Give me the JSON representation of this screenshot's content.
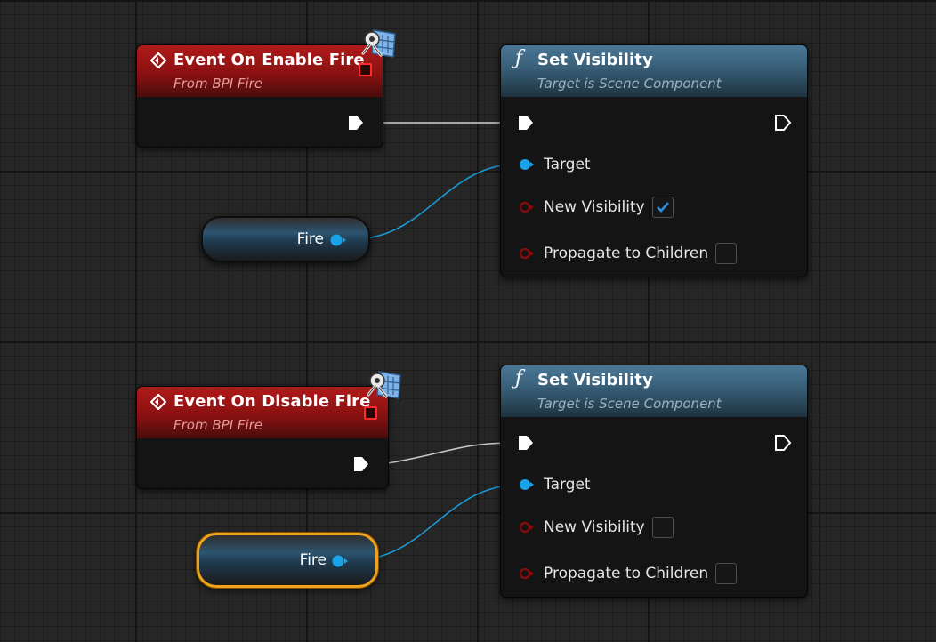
{
  "graph": {
    "event_nodes": [
      {
        "title": "Event On Enable Fire",
        "subtitle": "From BPI Fire"
      },
      {
        "title": "Event On Disable Fire",
        "subtitle": "From BPI Fire"
      }
    ],
    "function_nodes": [
      {
        "title": "Set Visibility",
        "subtitle": "Target is Scene Component",
        "pins": {
          "target": "Target",
          "new_visibility": "New Visibility",
          "propagate": "Propagate to Children"
        },
        "new_visibility_checked": true,
        "propagate_checked": false
      },
      {
        "title": "Set Visibility",
        "subtitle": "Target is Scene Component",
        "pins": {
          "target": "Target",
          "new_visibility": "New Visibility",
          "propagate": "Propagate to Children"
        },
        "new_visibility_checked": false,
        "propagate_checked": false
      }
    ],
    "variable_nodes": [
      {
        "label": "Fire",
        "selected": false
      },
      {
        "label": "Fire",
        "selected": true
      }
    ]
  },
  "colors": {
    "event_header": "#8a1111",
    "function_header": "#355a72",
    "object_pin": "#1aa3e6",
    "bool_pin": "#8a0b0b",
    "exec_pin": "#ffffff",
    "selection": "#f0a21a",
    "delegate_pin": "#ff2b2b"
  },
  "icons": {
    "event": "event-diamond-icon",
    "function": "function-f-icon",
    "interface": "blueprint-interface-icon",
    "exec": "exec-arrow-icon",
    "checkbox": "checkmark-icon"
  }
}
